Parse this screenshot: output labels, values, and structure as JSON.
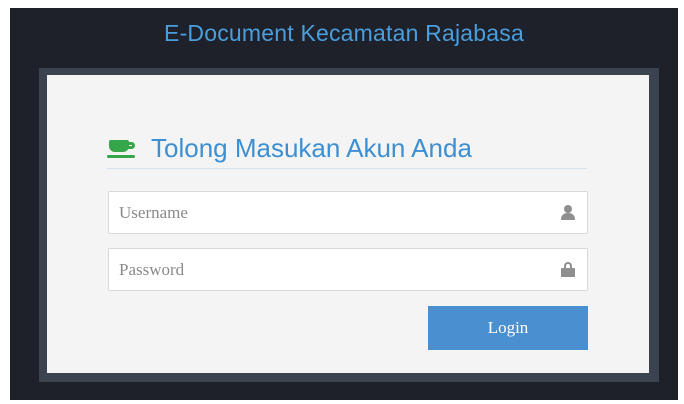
{
  "app": {
    "title": "E-Document Kecamatan Rajabasa"
  },
  "login_panel": {
    "heading": "Tolong Masukan Akun Anda",
    "heading_icon": "coffee-cup-icon",
    "username": {
      "value": "",
      "placeholder": "Username",
      "icon": "user-icon"
    },
    "password": {
      "value": "",
      "placeholder": "Password",
      "icon": "lock-icon"
    },
    "login_label": "Login"
  },
  "colors": {
    "background": "#1e2129",
    "title": "#4a9ede",
    "panel": "#f4f4f4",
    "heading": "#3d8fd1",
    "icon_accent": "#36a64a",
    "button": "#4a8fd0"
  }
}
